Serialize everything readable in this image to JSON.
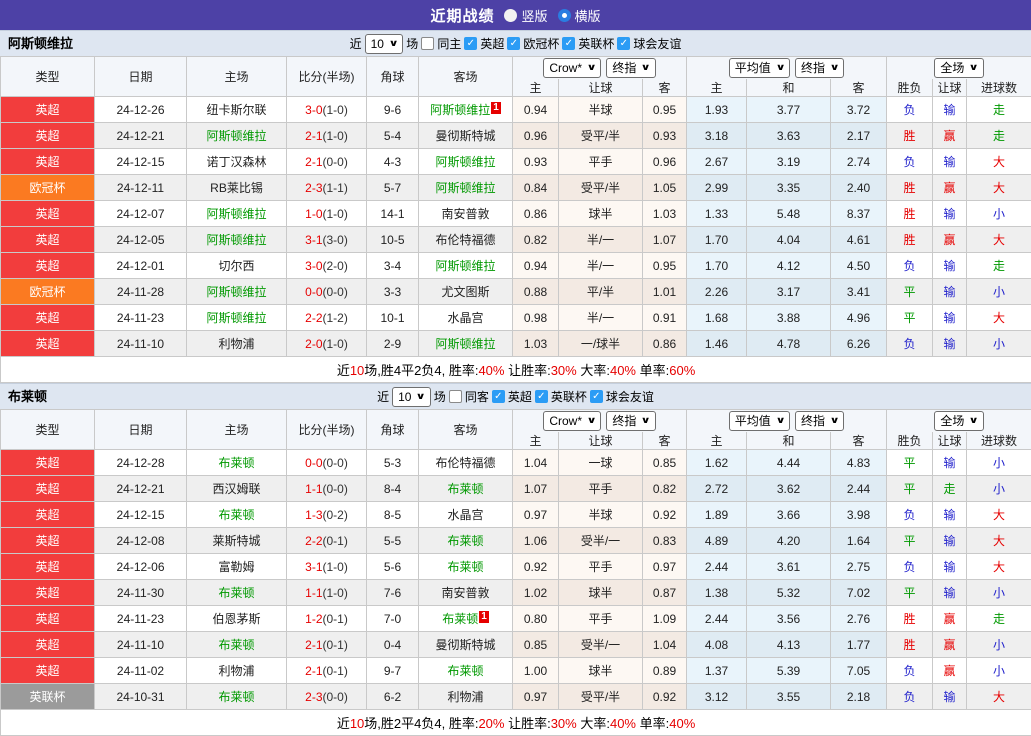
{
  "title_bar": {
    "title": "近期战绩",
    "vertical_label": "竖版",
    "horizontal_label": "横版",
    "selected": "横版"
  },
  "colors": {
    "titlebar_bg": "#4d41a6",
    "band_bg": "#dee6f1",
    "type_badges": {
      "英超": "#f23d3d",
      "欧冠杯": "#fb7a21",
      "英联杯": "#9b9b9b"
    },
    "team_highlight": "#009900",
    "score_red": "#e60000",
    "result_red": "#e60000",
    "result_green": "#009900",
    "result_blue": "#2222cc"
  },
  "table_header": {
    "left_cols": [
      "类型",
      "日期",
      "主场",
      "比分(半场)",
      "角球",
      "客场"
    ],
    "odds_group": {
      "select1": "Crow*",
      "select2": "终指",
      "labels": [
        "主",
        "让球",
        "客"
      ]
    },
    "avg_group": {
      "select1": "平均值",
      "select2": "终指",
      "labels": [
        "主",
        "和",
        "客"
      ]
    },
    "result_group": {
      "select": "全场",
      "labels": [
        "胜负",
        "让球",
        "进球数"
      ]
    }
  },
  "filter_labels": {
    "near": "近",
    "matches": "场"
  },
  "sections": [
    {
      "team": "阿斯顿维拉",
      "filter": {
        "count": "10",
        "same_label": "同主",
        "same_checked": false,
        "leagues": [
          "英超",
          "欧冠杯",
          "英联杯",
          "球会友谊"
        ]
      },
      "rows": [
        {
          "type": "英超",
          "date": "24-12-26",
          "home": "纽卡斯尔联",
          "home_hl": false,
          "away": "阿斯顿维拉",
          "away_hl": true,
          "away_badge": "1",
          "score": "3-0",
          "half": "(1-0)",
          "corners": "9-6",
          "o1": "0.94",
          "handicap": "半球",
          "o2": "0.95",
          "a1": "1.93",
          "a2": "3.77",
          "a3": "3.72",
          "r1": "负",
          "r2": "输",
          "r3": "走"
        },
        {
          "type": "英超",
          "date": "24-12-21",
          "home": "阿斯顿维拉",
          "home_hl": true,
          "away": "曼彻斯特城",
          "away_hl": false,
          "score": "2-1",
          "half": "(1-0)",
          "corners": "5-4",
          "o1": "0.96",
          "handicap": "受平/半",
          "o2": "0.93",
          "a1": "3.18",
          "a2": "3.63",
          "a3": "2.17",
          "r1": "胜",
          "r2": "赢",
          "r3": "走"
        },
        {
          "type": "英超",
          "date": "24-12-15",
          "home": "诺丁汉森林",
          "home_hl": false,
          "away": "阿斯顿维拉",
          "away_hl": true,
          "score": "2-1",
          "half": "(0-0)",
          "corners": "4-3",
          "o1": "0.93",
          "handicap": "平手",
          "o2": "0.96",
          "a1": "2.67",
          "a2": "3.19",
          "a3": "2.74",
          "r1": "负",
          "r2": "输",
          "r3": "大"
        },
        {
          "type": "欧冠杯",
          "date": "24-12-11",
          "home": "RB莱比锡",
          "home_hl": false,
          "away": "阿斯顿维拉",
          "away_hl": true,
          "score": "2-3",
          "half": "(1-1)",
          "corners": "5-7",
          "o1": "0.84",
          "handicap": "受平/半",
          "o2": "1.05",
          "a1": "2.99",
          "a2": "3.35",
          "a3": "2.40",
          "r1": "胜",
          "r2": "赢",
          "r3": "大"
        },
        {
          "type": "英超",
          "date": "24-12-07",
          "home": "阿斯顿维拉",
          "home_hl": true,
          "away": "南安普敦",
          "away_hl": false,
          "score": "1-0",
          "half": "(1-0)",
          "corners": "14-1",
          "o1": "0.86",
          "handicap": "球半",
          "o2": "1.03",
          "a1": "1.33",
          "a2": "5.48",
          "a3": "8.37",
          "r1": "胜",
          "r2": "输",
          "r3": "小"
        },
        {
          "type": "英超",
          "date": "24-12-05",
          "home": "阿斯顿维拉",
          "home_hl": true,
          "away": "布伦特福德",
          "away_hl": false,
          "score": "3-1",
          "half": "(3-0)",
          "corners": "10-5",
          "o1": "0.82",
          "handicap": "半/一",
          "o2": "1.07",
          "a1": "1.70",
          "a2": "4.04",
          "a3": "4.61",
          "r1": "胜",
          "r2": "赢",
          "r3": "大"
        },
        {
          "type": "英超",
          "date": "24-12-01",
          "home": "切尔西",
          "home_hl": false,
          "away": "阿斯顿维拉",
          "away_hl": true,
          "score": "3-0",
          "half": "(2-0)",
          "corners": "3-4",
          "o1": "0.94",
          "handicap": "半/一",
          "o2": "0.95",
          "a1": "1.70",
          "a2": "4.12",
          "a3": "4.50",
          "r1": "负",
          "r2": "输",
          "r3": "走"
        },
        {
          "type": "欧冠杯",
          "date": "24-11-28",
          "home": "阿斯顿维拉",
          "home_hl": true,
          "away": "尤文图斯",
          "away_hl": false,
          "score": "0-0",
          "half": "(0-0)",
          "corners": "3-3",
          "o1": "0.88",
          "handicap": "平/半",
          "o2": "1.01",
          "a1": "2.26",
          "a2": "3.17",
          "a3": "3.41",
          "r1": "平",
          "r2": "输",
          "r3": "小"
        },
        {
          "type": "英超",
          "date": "24-11-23",
          "home": "阿斯顿维拉",
          "home_hl": true,
          "away": "水晶宫",
          "away_hl": false,
          "score": "2-2",
          "half": "(1-2)",
          "corners": "10-1",
          "o1": "0.98",
          "handicap": "半/一",
          "o2": "0.91",
          "a1": "1.68",
          "a2": "3.88",
          "a3": "4.96",
          "r1": "平",
          "r2": "输",
          "r3": "大"
        },
        {
          "type": "英超",
          "date": "24-11-10",
          "home": "利物浦",
          "home_hl": false,
          "away": "阿斯顿维拉",
          "away_hl": true,
          "score": "2-0",
          "half": "(1-0)",
          "corners": "2-9",
          "o1": "1.03",
          "handicap": "一/球半",
          "o2": "0.86",
          "a1": "1.46",
          "a2": "4.78",
          "a3": "6.26",
          "r1": "负",
          "r2": "输",
          "r3": "小"
        }
      ],
      "summary": [
        {
          "t": "近",
          "r": false
        },
        {
          "t": "10",
          "r": true
        },
        {
          "t": "场,胜4平2负4, 胜率:",
          "r": false
        },
        {
          "t": "40%",
          "r": true
        },
        {
          "t": " 让胜率:",
          "r": false
        },
        {
          "t": "30%",
          "r": true
        },
        {
          "t": " 大率:",
          "r": false
        },
        {
          "t": "40%",
          "r": true
        },
        {
          "t": " 单率:",
          "r": false
        },
        {
          "t": "60%",
          "r": true
        }
      ]
    },
    {
      "team": "布莱顿",
      "filter": {
        "count": "10",
        "same_label": "同客",
        "same_checked": false,
        "leagues": [
          "英超",
          "英联杯",
          "球会友谊"
        ]
      },
      "rows": [
        {
          "type": "英超",
          "date": "24-12-28",
          "home": "布莱顿",
          "home_hl": true,
          "away": "布伦特福德",
          "away_hl": false,
          "score": "0-0",
          "half": "(0-0)",
          "corners": "5-3",
          "o1": "1.04",
          "handicap": "一球",
          "o2": "0.85",
          "a1": "1.62",
          "a2": "4.44",
          "a3": "4.83",
          "r1": "平",
          "r2": "输",
          "r3": "小"
        },
        {
          "type": "英超",
          "date": "24-12-21",
          "home": "西汉姆联",
          "home_hl": false,
          "away": "布莱顿",
          "away_hl": true,
          "score": "1-1",
          "half": "(0-0)",
          "corners": "8-4",
          "o1": "1.07",
          "handicap": "平手",
          "o2": "0.82",
          "a1": "2.72",
          "a2": "3.62",
          "a3": "2.44",
          "r1": "平",
          "r2": "走",
          "r3": "小"
        },
        {
          "type": "英超",
          "date": "24-12-15",
          "home": "布莱顿",
          "home_hl": true,
          "away": "水晶宫",
          "away_hl": false,
          "score": "1-3",
          "half": "(0-2)",
          "corners": "8-5",
          "o1": "0.97",
          "handicap": "半球",
          "o2": "0.92",
          "a1": "1.89",
          "a2": "3.66",
          "a3": "3.98",
          "r1": "负",
          "r2": "输",
          "r3": "大"
        },
        {
          "type": "英超",
          "date": "24-12-08",
          "home": "莱斯特城",
          "home_hl": false,
          "away": "布莱顿",
          "away_hl": true,
          "score": "2-2",
          "half": "(0-1)",
          "corners": "5-5",
          "o1": "1.06",
          "handicap": "受半/一",
          "o2": "0.83",
          "a1": "4.89",
          "a2": "4.20",
          "a3": "1.64",
          "r1": "平",
          "r2": "输",
          "r3": "大"
        },
        {
          "type": "英超",
          "date": "24-12-06",
          "home": "富勒姆",
          "home_hl": false,
          "away": "布莱顿",
          "away_hl": true,
          "score": "3-1",
          "half": "(1-0)",
          "corners": "5-6",
          "o1": "0.92",
          "handicap": "平手",
          "o2": "0.97",
          "a1": "2.44",
          "a2": "3.61",
          "a3": "2.75",
          "r1": "负",
          "r2": "输",
          "r3": "大"
        },
        {
          "type": "英超",
          "date": "24-11-30",
          "home": "布莱顿",
          "home_hl": true,
          "away": "南安普敦",
          "away_hl": false,
          "score": "1-1",
          "half": "(1-0)",
          "corners": "7-6",
          "o1": "1.02",
          "handicap": "球半",
          "o2": "0.87",
          "a1": "1.38",
          "a2": "5.32",
          "a3": "7.02",
          "r1": "平",
          "r2": "输",
          "r3": "小"
        },
        {
          "type": "英超",
          "date": "24-11-23",
          "home": "伯恩茅斯",
          "home_hl": false,
          "away": "布莱顿",
          "away_hl": true,
          "away_badge": "1",
          "score": "1-2",
          "half": "(0-1)",
          "corners": "7-0",
          "o1": "0.80",
          "handicap": "平手",
          "o2": "1.09",
          "a1": "2.44",
          "a2": "3.56",
          "a3": "2.76",
          "r1": "胜",
          "r2": "赢",
          "r3": "走"
        },
        {
          "type": "英超",
          "date": "24-11-10",
          "home": "布莱顿",
          "home_hl": true,
          "away": "曼彻斯特城",
          "away_hl": false,
          "score": "2-1",
          "half": "(0-1)",
          "corners": "0-4",
          "o1": "0.85",
          "handicap": "受半/一",
          "o2": "1.04",
          "a1": "4.08",
          "a2": "4.13",
          "a3": "1.77",
          "r1": "胜",
          "r2": "赢",
          "r3": "小"
        },
        {
          "type": "英超",
          "date": "24-11-02",
          "home": "利物浦",
          "home_hl": false,
          "away": "布莱顿",
          "away_hl": true,
          "score": "2-1",
          "half": "(0-1)",
          "corners": "9-7",
          "o1": "1.00",
          "handicap": "球半",
          "o2": "0.89",
          "a1": "1.37",
          "a2": "5.39",
          "a3": "7.05",
          "r1": "负",
          "r2": "赢",
          "r3": "小"
        },
        {
          "type": "英联杯",
          "date": "24-10-31",
          "home": "布莱顿",
          "home_hl": true,
          "away": "利物浦",
          "away_hl": false,
          "score": "2-3",
          "half": "(0-0)",
          "corners": "6-2",
          "o1": "0.97",
          "handicap": "受平/半",
          "o2": "0.92",
          "a1": "3.12",
          "a2": "3.55",
          "a3": "2.18",
          "r1": "负",
          "r2": "输",
          "r3": "大"
        }
      ],
      "summary": [
        {
          "t": "近",
          "r": false
        },
        {
          "t": "10",
          "r": true
        },
        {
          "t": "场,胜2平4负4, 胜率:",
          "r": false
        },
        {
          "t": "20%",
          "r": true
        },
        {
          "t": " 让胜率:",
          "r": false
        },
        {
          "t": "30%",
          "r": true
        },
        {
          "t": " 大率:",
          "r": false
        },
        {
          "t": "40%",
          "r": true
        },
        {
          "t": " 单率:",
          "r": false
        },
        {
          "t": "40%",
          "r": true
        }
      ]
    }
  ]
}
